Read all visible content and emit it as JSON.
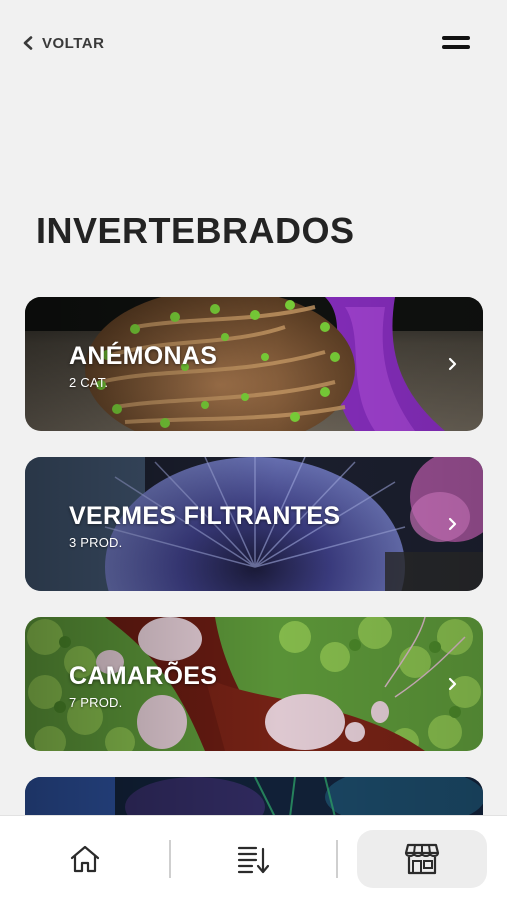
{
  "header": {
    "back_label": "VOLTAR",
    "back_icon": "chevron-left-icon",
    "menu_icon": "menu-icon"
  },
  "page": {
    "title": "INVERTEBRADOS"
  },
  "categories": [
    {
      "title": "ANÉMONAS",
      "subtitle": "2 CAT.",
      "image": "anemone-photo"
    },
    {
      "title": "VERMES FILTRANTES",
      "subtitle": "3 PROD.",
      "image": "fan-worm-photo"
    },
    {
      "title": "CAMARÕES",
      "subtitle": "7 PROD.",
      "image": "shrimp-photo"
    },
    {
      "title": "",
      "subtitle": "",
      "image": "partially-visible-photo"
    }
  ],
  "bottom_nav": {
    "items": [
      {
        "icon": "home-icon",
        "active": false
      },
      {
        "icon": "sort-list-icon",
        "active": false
      },
      {
        "icon": "store-icon",
        "active": true
      }
    ]
  },
  "colors": {
    "background": "#f1f1f1",
    "text": "#232323",
    "nav_active_bg": "#ededed"
  }
}
